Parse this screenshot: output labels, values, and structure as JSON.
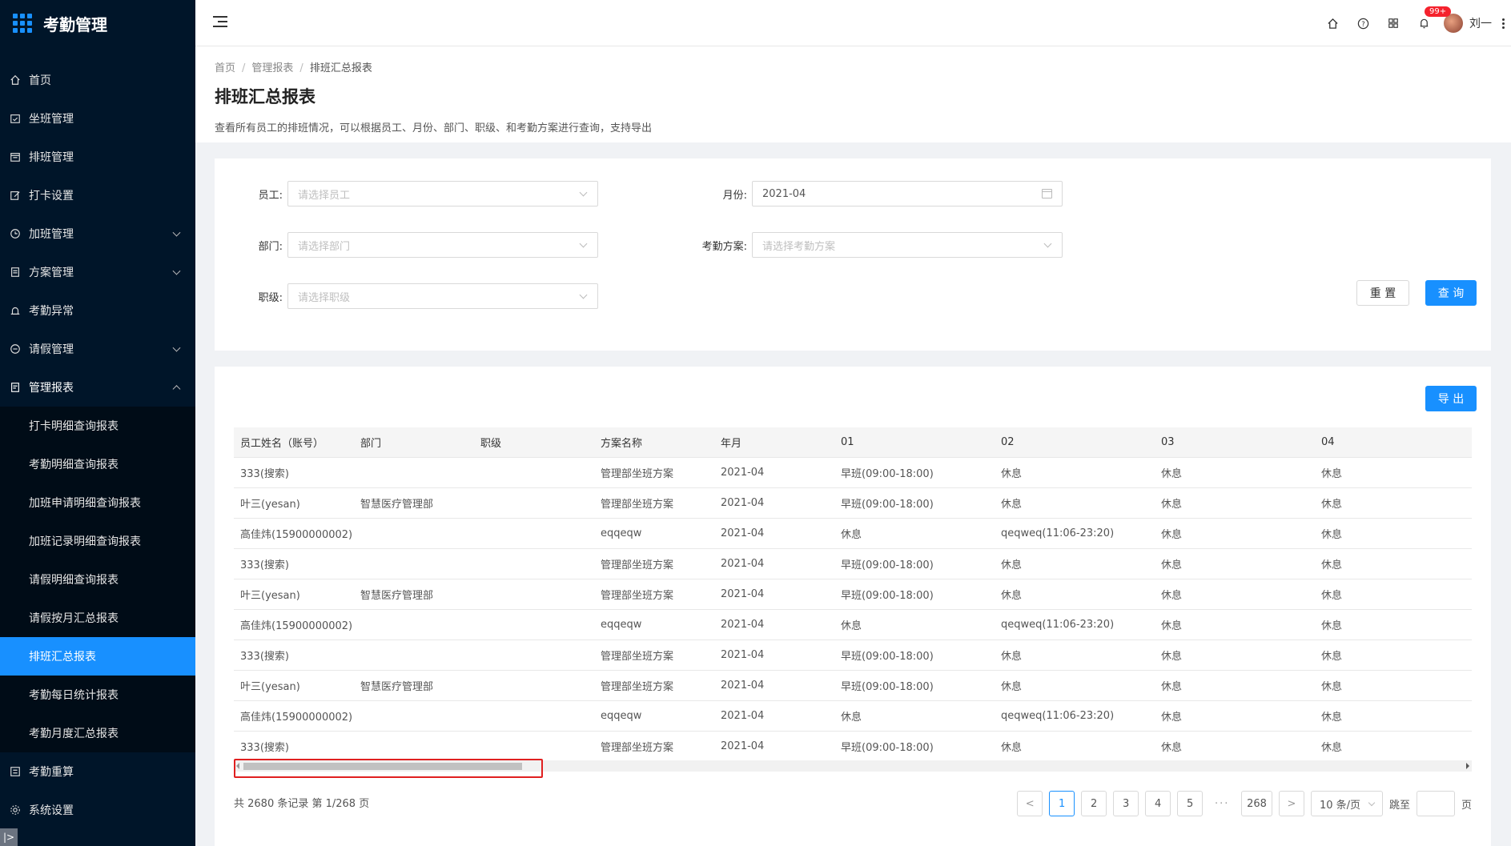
{
  "app": {
    "title": "考勤管理"
  },
  "sidebar": {
    "items": [
      {
        "label": "首页",
        "icon": "home-icon"
      },
      {
        "label": "坐班管理",
        "icon": "calendar-check-icon"
      },
      {
        "label": "排班管理",
        "icon": "schedule-icon"
      },
      {
        "label": "打卡设置",
        "icon": "edit-icon"
      },
      {
        "label": "加班管理",
        "icon": "clock-icon",
        "expandable": true
      },
      {
        "label": "方案管理",
        "icon": "document-icon",
        "expandable": true
      },
      {
        "label": "考勤异常",
        "icon": "alarm-icon"
      },
      {
        "label": "请假管理",
        "icon": "leave-icon",
        "expandable": true
      },
      {
        "label": "管理报表",
        "icon": "report-icon",
        "expanded": true
      }
    ],
    "submenu": [
      {
        "label": "打卡明细查询报表"
      },
      {
        "label": "考勤明细查询报表"
      },
      {
        "label": "加班申请明细查询报表"
      },
      {
        "label": "加班记录明细查询报表"
      },
      {
        "label": "请假明细查询报表"
      },
      {
        "label": "请假按月汇总报表"
      },
      {
        "label": "排班汇总报表",
        "active": true
      },
      {
        "label": "考勤每日统计报表"
      },
      {
        "label": "考勤月度汇总报表"
      }
    ],
    "bottom_items": [
      {
        "label": "考勤重算",
        "icon": "recalc-icon"
      },
      {
        "label": "系统设置",
        "icon": "gear-icon"
      }
    ],
    "collapse_label": "|>"
  },
  "topbar": {
    "notification_badge": "99+",
    "user_name": "刘一"
  },
  "breadcrumb": {
    "items": [
      "首页",
      "管理报表",
      "排班汇总报表"
    ]
  },
  "page": {
    "title": "排班汇总报表",
    "description": "查看所有员工的排班情况，可以根据员工、月份、部门、职级、和考勤方案进行查询，支持导出"
  },
  "filters": {
    "employee": {
      "label": "员工:",
      "placeholder": "请选择员工"
    },
    "month": {
      "label": "月份:",
      "value": "2021-04"
    },
    "department": {
      "label": "部门:",
      "placeholder": "请选择部门"
    },
    "scheme": {
      "label": "考勤方案:",
      "placeholder": "请选择考勤方案"
    },
    "level": {
      "label": "职级:",
      "placeholder": "请选择职级"
    },
    "reset_label": "重 置",
    "query_label": "查 询"
  },
  "table": {
    "export_label": "导 出",
    "columns": [
      "员工姓名（账号）",
      "部门",
      "职级",
      "方案名称",
      "年月",
      "01",
      "02",
      "03",
      "04"
    ],
    "rows": [
      [
        "333(搜索)",
        "",
        "",
        "管理部坐班方案",
        "2021-04",
        "早班(09:00-18:00)",
        "休息",
        "休息",
        "休息"
      ],
      [
        "叶三(yesan)",
        "智慧医疗管理部",
        "",
        "管理部坐班方案",
        "2021-04",
        "早班(09:00-18:00)",
        "休息",
        "休息",
        "休息"
      ],
      [
        "高佳炜(15900000002)",
        "",
        "",
        "eqqeqw",
        "2021-04",
        "休息",
        "qeqweq(11:06-23:20)",
        "休息",
        "休息"
      ],
      [
        "333(搜索)",
        "",
        "",
        "管理部坐班方案",
        "2021-04",
        "早班(09:00-18:00)",
        "休息",
        "休息",
        "休息"
      ],
      [
        "叶三(yesan)",
        "智慧医疗管理部",
        "",
        "管理部坐班方案",
        "2021-04",
        "早班(09:00-18:00)",
        "休息",
        "休息",
        "休息"
      ],
      [
        "高佳炜(15900000002)",
        "",
        "",
        "eqqeqw",
        "2021-04",
        "休息",
        "qeqweq(11:06-23:20)",
        "休息",
        "休息"
      ],
      [
        "333(搜索)",
        "",
        "",
        "管理部坐班方案",
        "2021-04",
        "早班(09:00-18:00)",
        "休息",
        "休息",
        "休息"
      ],
      [
        "叶三(yesan)",
        "智慧医疗管理部",
        "",
        "管理部坐班方案",
        "2021-04",
        "早班(09:00-18:00)",
        "休息",
        "休息",
        "休息"
      ],
      [
        "高佳炜(15900000002)",
        "",
        "",
        "eqqeqw",
        "2021-04",
        "休息",
        "qeqweq(11:06-23:20)",
        "休息",
        "休息"
      ],
      [
        "333(搜索)",
        "",
        "",
        "管理部坐班方案",
        "2021-04",
        "早班(09:00-18:00)",
        "休息",
        "休息",
        "休息"
      ]
    ]
  },
  "pagination": {
    "total_text": "共 2680 条记录 第 1/268 页",
    "prev": "<",
    "next": ">",
    "pages": [
      "1",
      "2",
      "3",
      "4",
      "5"
    ],
    "dots": "···",
    "last": "268",
    "page_size": "10 条/页",
    "jump_label": "跳至",
    "page_suffix": "页"
  }
}
